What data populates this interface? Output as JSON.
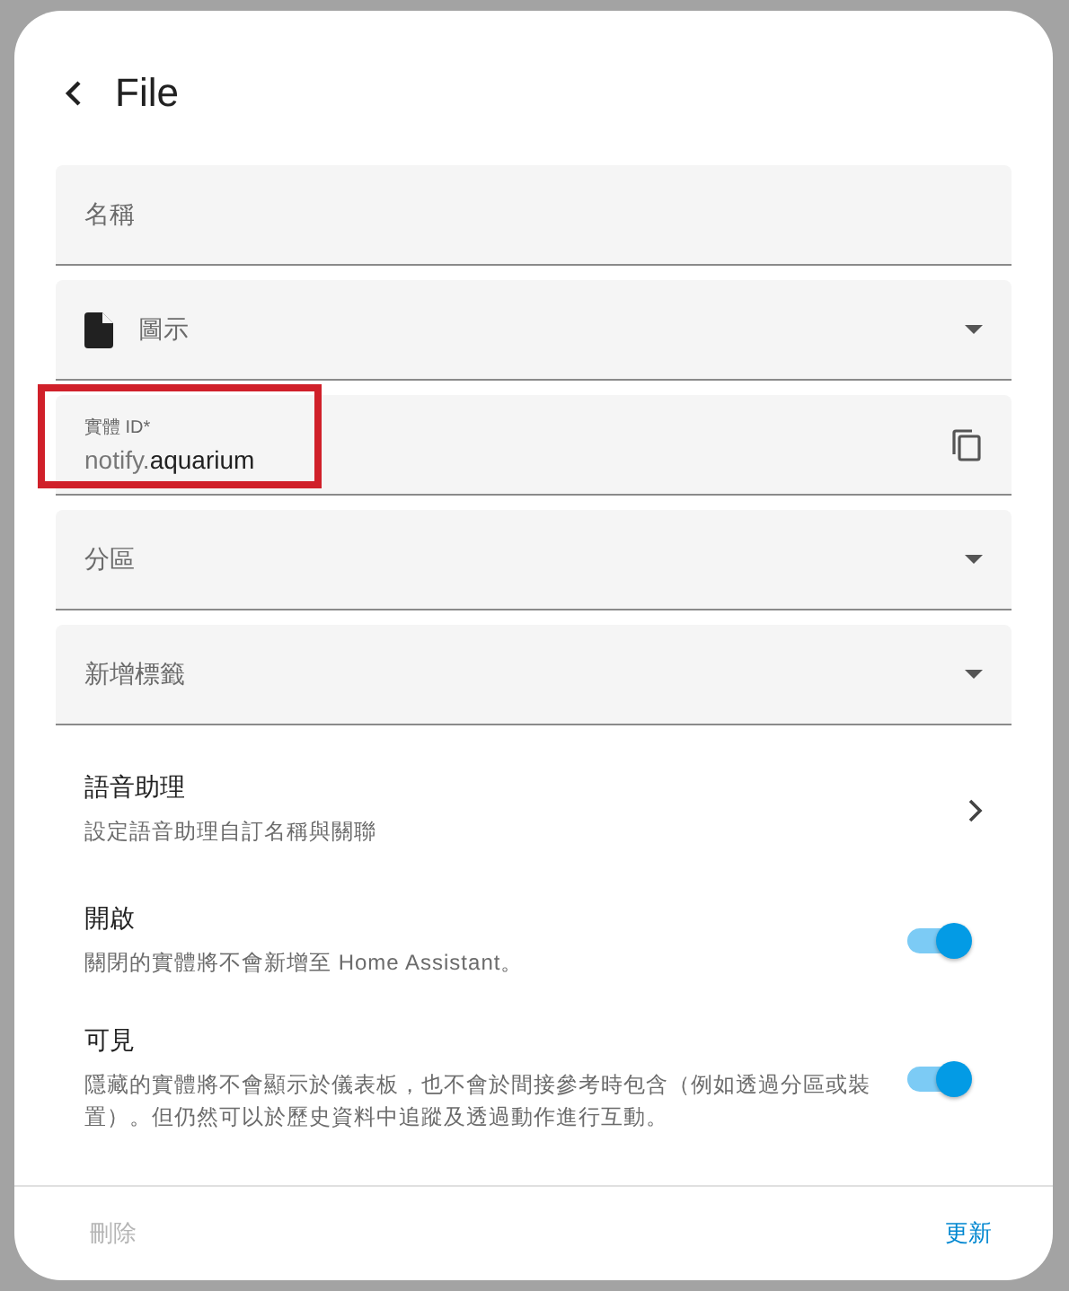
{
  "dialog": {
    "title": "File"
  },
  "fields": [
    {
      "kind": "text",
      "label": "名稱"
    },
    {
      "kind": "select",
      "label": "圖示",
      "has_icon": true
    },
    {
      "kind": "entity_id",
      "label": "實體 ID*",
      "value_prefix": "notify.",
      "value": "aquarium",
      "highlighted": true
    },
    {
      "kind": "select",
      "label": "分區"
    },
    {
      "kind": "select",
      "label": "新增標籤"
    }
  ],
  "settings": [
    {
      "kind": "link",
      "title": "語音助理",
      "description": "設定語音助理自訂名稱與關聯"
    },
    {
      "kind": "toggle",
      "title": "開啟",
      "description": "關閉的實體將不會新增至 Home Assistant。",
      "on": true
    },
    {
      "kind": "toggle",
      "title": "可見",
      "description": "隱藏的實體將不會顯示於儀表板，也不會於間接參考時包含（例如透過分區或裝置）。但仍然可以於歷史資料中追蹤及透過動作進行互動。",
      "on": true
    }
  ],
  "footer": {
    "buttons": [
      {
        "label": "刪除",
        "disabled": true
      },
      {
        "label": "更新",
        "disabled": false
      }
    ]
  }
}
